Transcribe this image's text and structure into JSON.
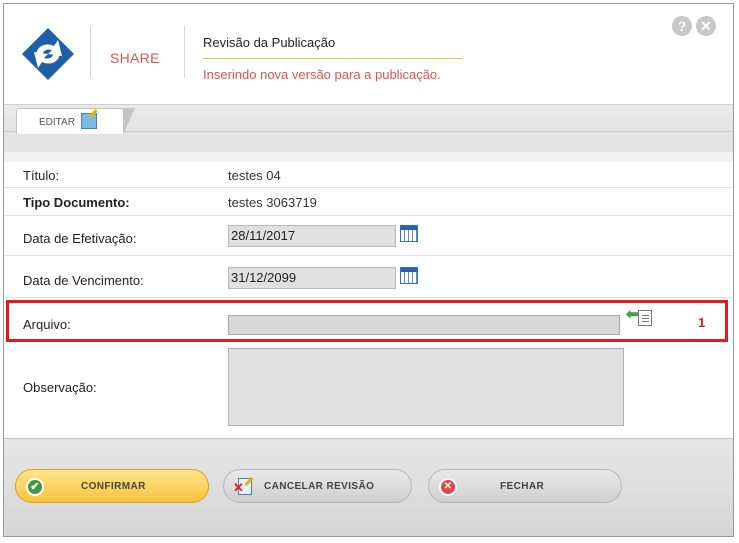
{
  "header": {
    "brand": "SHARE",
    "title": "Revisão da Publicação",
    "subtitle": "Inserindo nova versão para a publicação.",
    "help_icon": "?",
    "close_icon": "✕"
  },
  "tabs": [
    {
      "label": "EDITAR",
      "icon": "edit-icon"
    }
  ],
  "form": {
    "titulo": {
      "label": "Título:",
      "value": "testes 04"
    },
    "tipo_documento": {
      "label": "Tipo Documento:",
      "value": "testes 3063719"
    },
    "data_efetivacao": {
      "label": "Data de Efetivação:",
      "value": "28/11/2017"
    },
    "data_vencimento": {
      "label": "Data de Vencimento:",
      "value": "31/12/2099"
    },
    "arquivo": {
      "label": "Arquivo:",
      "value": "",
      "marker": "1"
    },
    "observacao": {
      "label": "Observação:",
      "value": ""
    }
  },
  "footer": {
    "confirm_label": "CONFIRMAR",
    "cancel_label": "CANCELAR REVISÃO",
    "close_label": "FECHAR"
  },
  "colors": {
    "accent_red": "#d9534f",
    "highlight_red": "#e01b1b",
    "confirm_yellow": "#f6c33b",
    "title_underline": "#f0c330"
  }
}
